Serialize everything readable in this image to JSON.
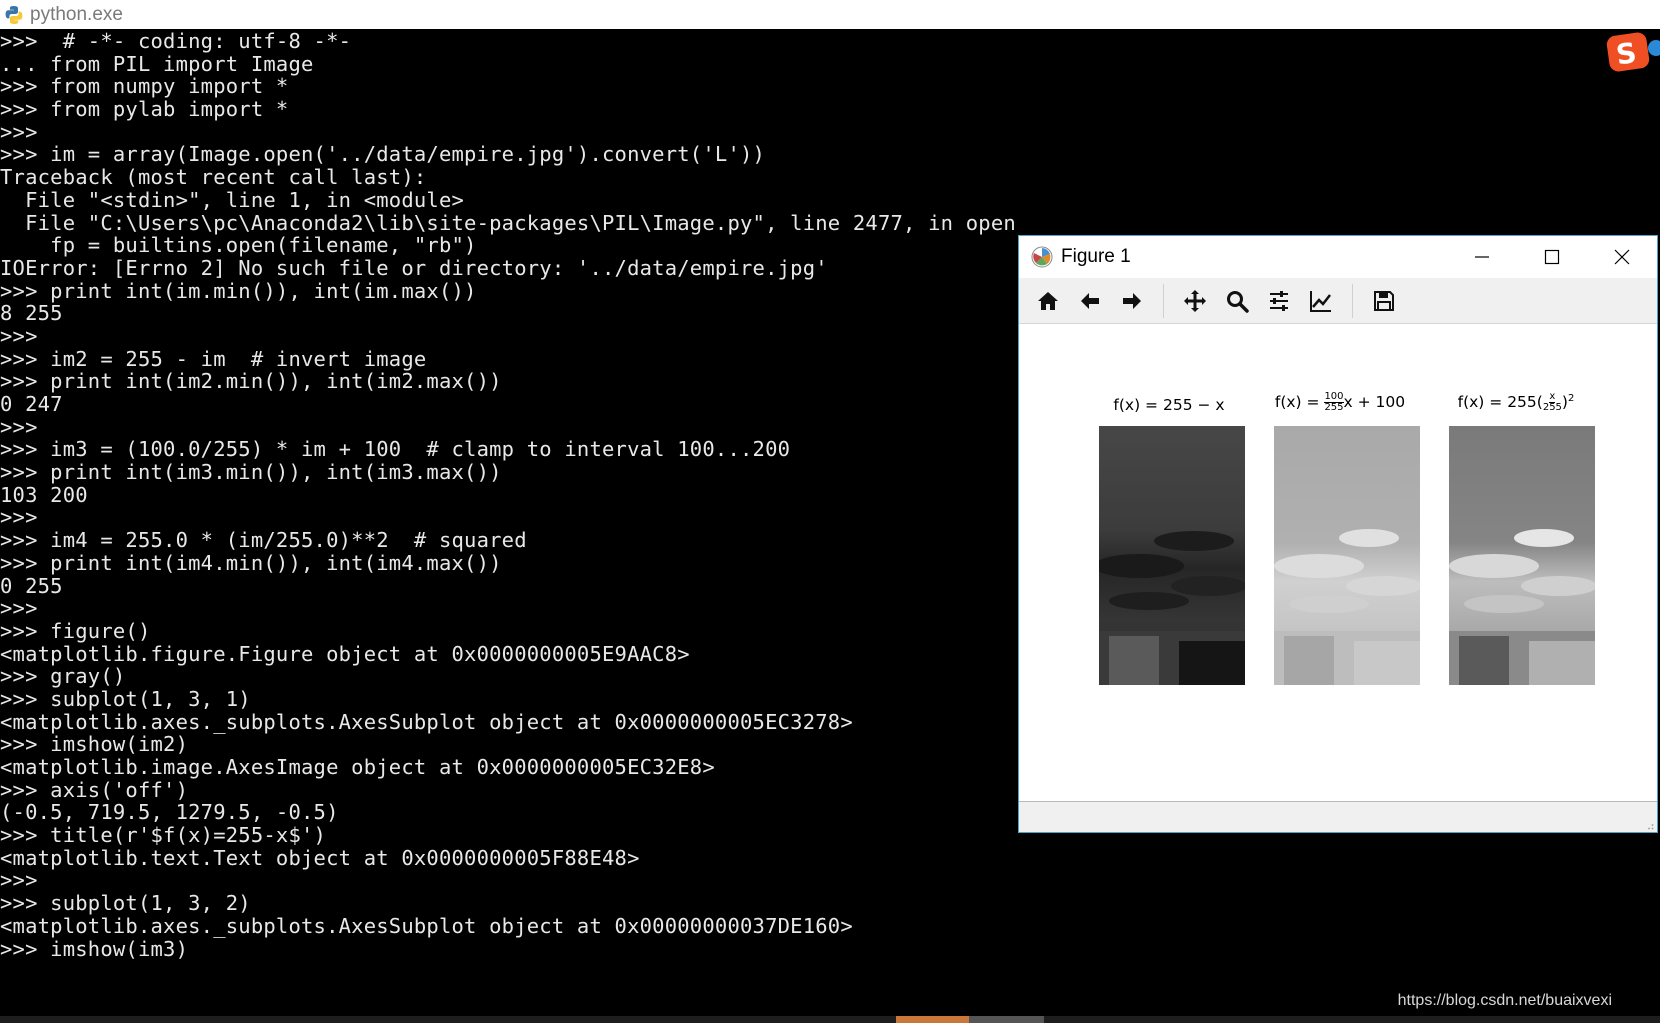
{
  "console": {
    "window_title": "python.exe",
    "lines": [
      ">>>  # -*- coding: utf-8 -*-",
      "... from PIL import Image",
      ">>> from numpy import *",
      ">>> from pylab import *",
      ">>>",
      ">>> im = array(Image.open('../data/empire.jpg').convert('L'))",
      "Traceback (most recent call last):",
      "  File \"<stdin>\", line 1, in <module>",
      "  File \"C:\\Users\\pc\\Anaconda2\\lib\\site-packages\\PIL\\Image.py\", line 2477, in open",
      "    fp = builtins.open(filename, \"rb\")",
      "IOError: [Errno 2] No such file or directory: '../data/empire.jpg'",
      ">>> print int(im.min()), int(im.max())",
      "8 255",
      ">>>",
      ">>> im2 = 255 - im  # invert image",
      ">>> print int(im2.min()), int(im2.max())",
      "0 247",
      ">>>",
      ">>> im3 = (100.0/255) * im + 100  # clamp to interval 100...200",
      ">>> print int(im3.min()), int(im3.max())",
      "103 200",
      ">>>",
      ">>> im4 = 255.0 * (im/255.0)**2  # squared",
      ">>> print int(im4.min()), int(im4.max())",
      "0 255",
      ">>>",
      ">>> figure()",
      "<matplotlib.figure.Figure object at 0x0000000005E9AAC8>",
      ">>> gray()",
      ">>> subplot(1, 3, 1)",
      "<matplotlib.axes._subplots.AxesSubplot object at 0x0000000005EC3278>",
      ">>> imshow(im2)",
      "<matplotlib.image.AxesImage object at 0x0000000005EC32E8>",
      ">>> axis('off')",
      "(-0.5, 719.5, 1279.5, -0.5)",
      ">>> title(r'$f(x)=255-x$')",
      "<matplotlib.text.Text object at 0x0000000005F88E48>",
      ">>>",
      ">>> subplot(1, 3, 2)",
      "<matplotlib.axes._subplots.AxesSubplot object at 0x00000000037DE160>",
      ">>> imshow(im3)"
    ]
  },
  "watermark": "https://blog.csdn.net/buaixvexi",
  "figure": {
    "window_title": "Figure 1",
    "toolbar": [
      {
        "name": "home-icon"
      },
      {
        "name": "back-arrow-icon"
      },
      {
        "name": "forward-arrow-icon"
      },
      {
        "name": "pan-icon"
      },
      {
        "name": "zoom-icon"
      },
      {
        "name": "configure-subplots-icon"
      },
      {
        "name": "edit-axes-icon"
      },
      {
        "name": "save-icon"
      }
    ],
    "subplots": [
      {
        "title_prefix": "f(x) = 255 − x",
        "brightness": "dark"
      },
      {
        "title_prefix": "f(x) = ",
        "fraction_num": "100",
        "fraction_den": "255",
        "title_suffix": "x + 100",
        "brightness": "light"
      },
      {
        "title_prefix": "f(x) = 255(",
        "fraction_num": "x",
        "fraction_den": "255",
        "title_suffix": ")",
        "superscript": "2",
        "brightness": "mid"
      }
    ]
  },
  "colors": {
    "console_bg": "#000000",
    "console_fg": "#e8e8e8",
    "figure_border": "#4aa3c8",
    "ime_orange": "#f04e23"
  }
}
